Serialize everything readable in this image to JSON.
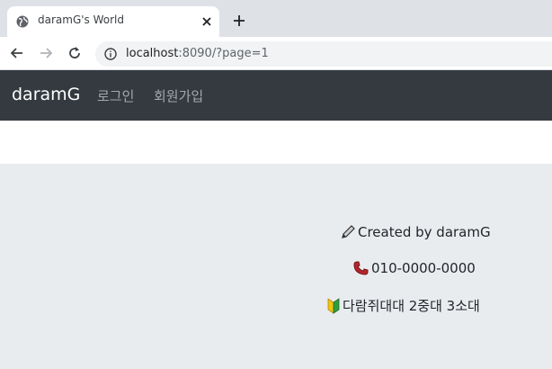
{
  "browser": {
    "tab_title": "daramG's World",
    "url_host": "localhost",
    "url_rest": ":8090/?page=1"
  },
  "navbar": {
    "brand": "daramG",
    "links": [
      "로그인",
      "회원가입"
    ]
  },
  "footer": {
    "created_by": "Created by daramG",
    "phone": "010-0000-0000",
    "address": "다람쥐대대 2중대 3소대"
  },
  "colors": {
    "navbar_bg": "#343a40",
    "page_bg": "#e9ecef"
  }
}
